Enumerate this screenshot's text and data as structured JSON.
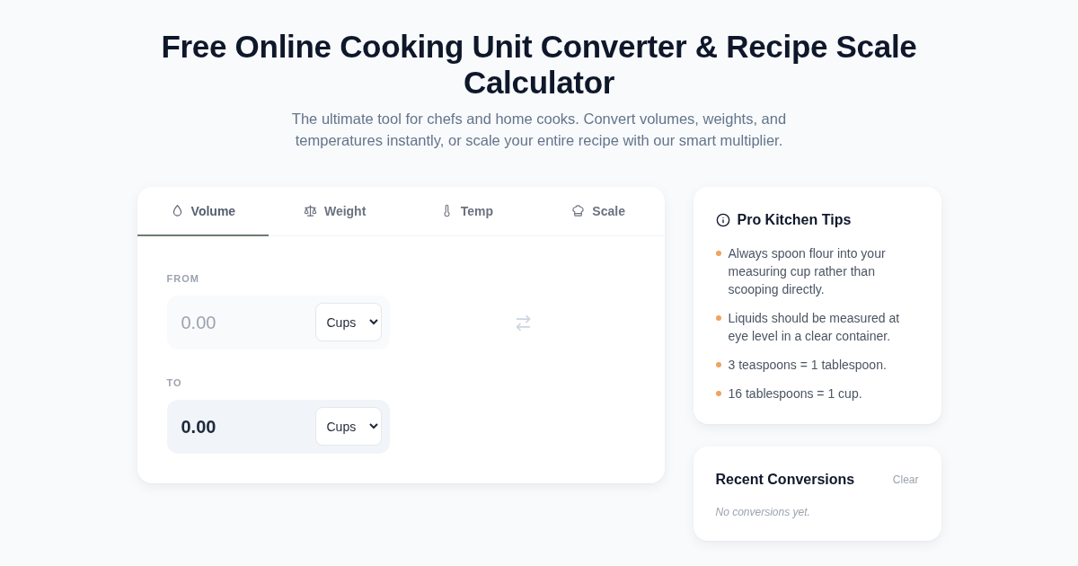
{
  "header": {
    "title": "Free Online Cooking Unit Converter & Recipe Scale Calculator",
    "subtitle": "The ultimate tool for chefs and home cooks. Convert volumes, weights, and temperatures instantly, or scale your entire recipe with our smart multiplier."
  },
  "converter": {
    "tabs": [
      {
        "label": "Volume",
        "selected": true
      },
      {
        "label": "Weight",
        "selected": false
      },
      {
        "label": "Temp",
        "selected": false
      },
      {
        "label": "Scale",
        "selected": false
      }
    ],
    "from": {
      "label": "FROM",
      "placeholder": "0.00",
      "unit": "Cups"
    },
    "to": {
      "label": "TO",
      "value": "0.00",
      "unit": "Cups"
    }
  },
  "tips": {
    "title": "Pro Kitchen Tips",
    "items": [
      "Always spoon flour into your measuring cup rather than scooping directly.",
      "Liquids should be measured at eye level in a clear container.",
      "3 teaspoons = 1 tablespoon.",
      "16 tablespoons = 1 cup."
    ]
  },
  "recent": {
    "title": "Recent Conversions",
    "clear": "Clear",
    "empty": "No conversions yet."
  }
}
